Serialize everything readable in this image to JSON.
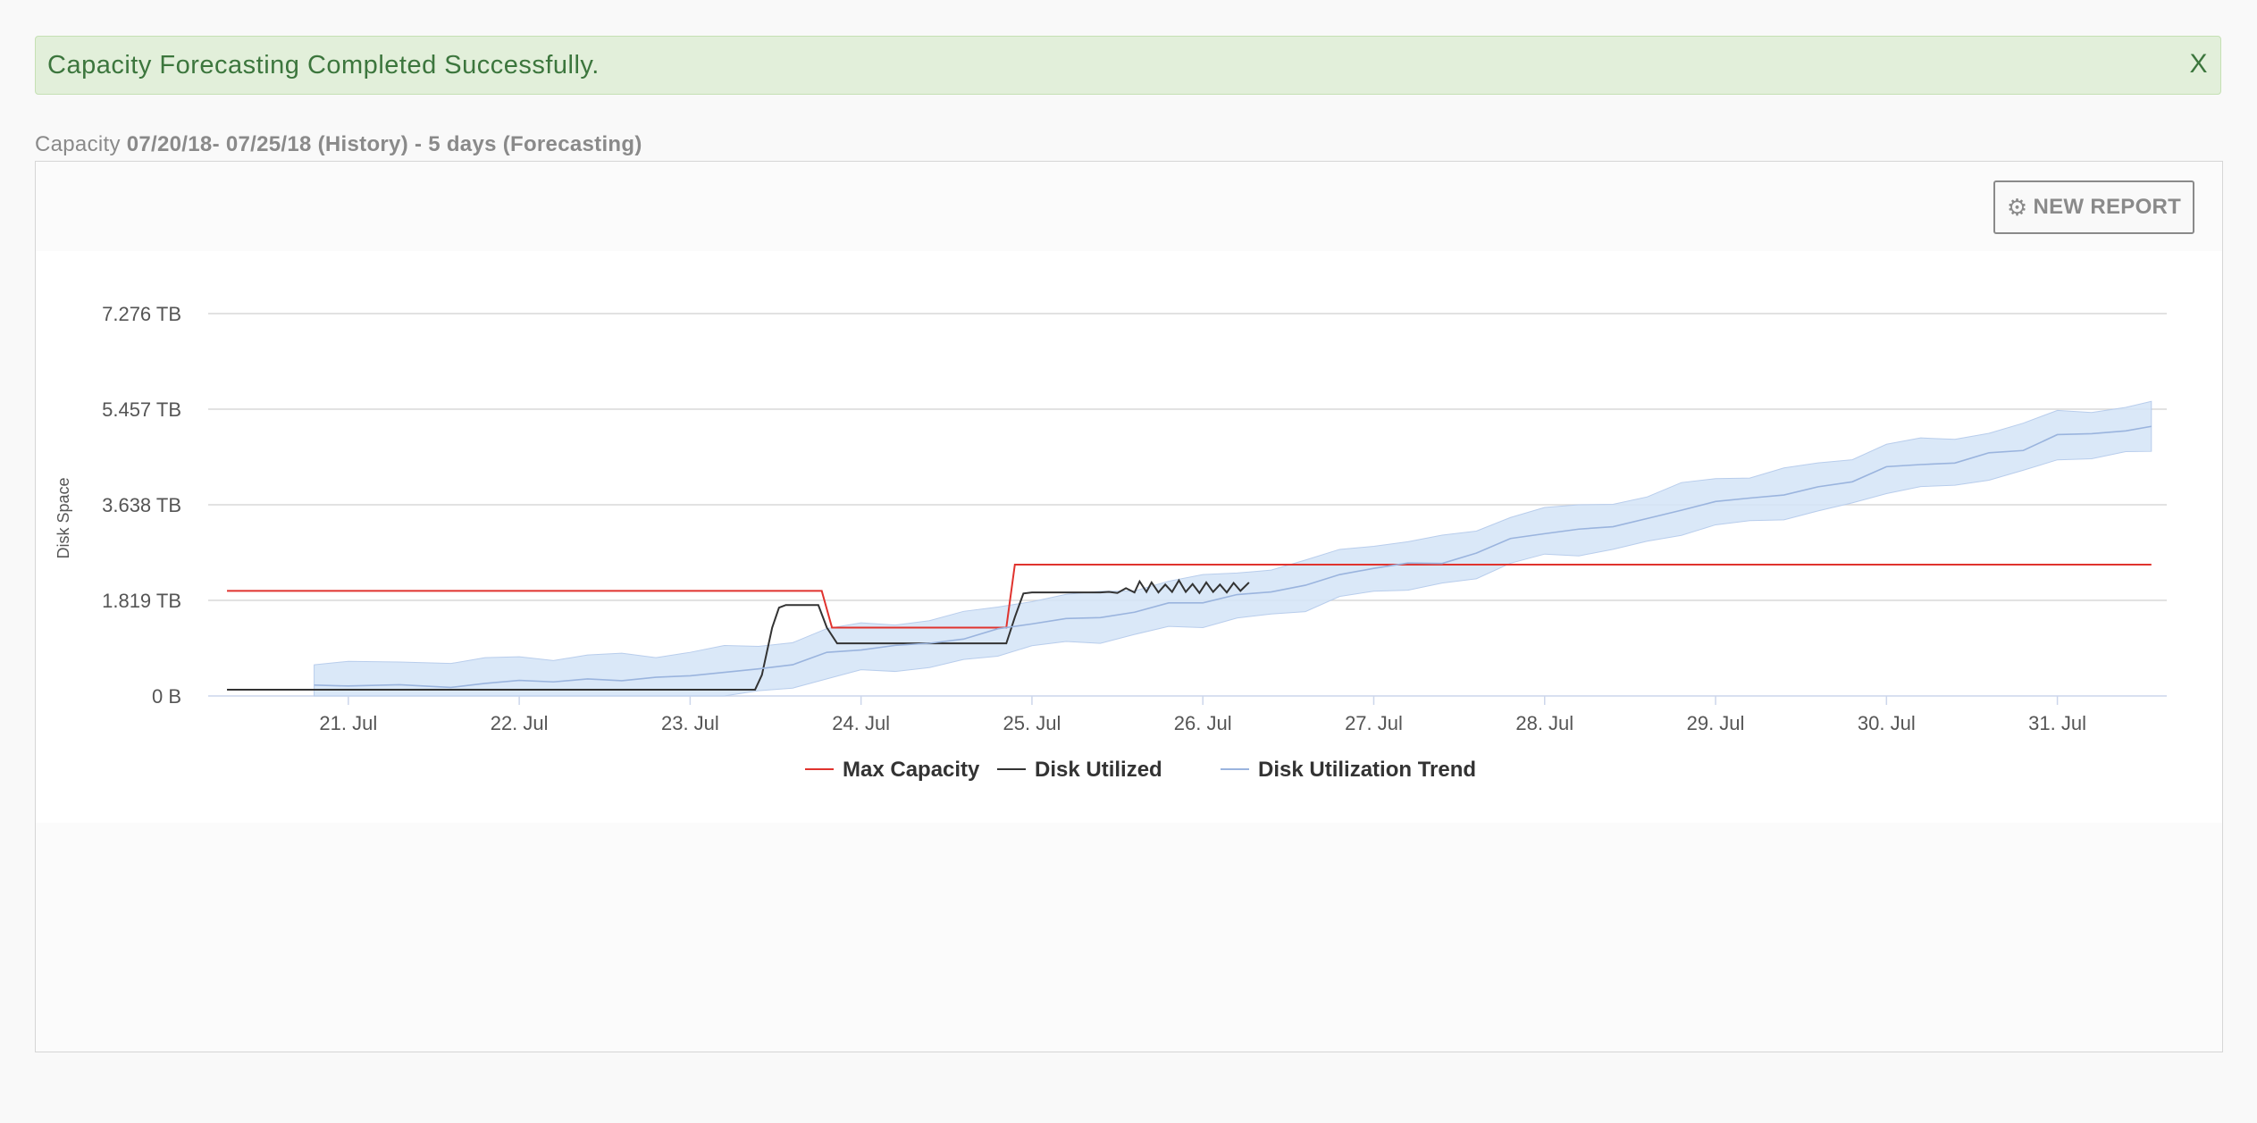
{
  "alert": {
    "message": "Capacity Forecasting Completed Successfully.",
    "close_label": "X"
  },
  "caption": {
    "prefix": "Capacity",
    "range": "07/20/18- 07/25/18 (History) - 5 days (Forecasting)"
  },
  "toolbar": {
    "new_report_label": "NEW REPORT",
    "new_report_icon": "gear-icon"
  },
  "colors": {
    "max_capacity": "#e0332e",
    "disk_utilized": "#333333",
    "trend_line": "#9ab4de",
    "trend_band": "#d4e4f7",
    "alert_bg": "#e2efda",
    "alert_text": "#3c763d"
  },
  "chart_data": {
    "type": "line",
    "title": "",
    "ylabel": "Disk Space",
    "xlabel": "",
    "x_unit": "day of July 2018",
    "xlim": [
      20.18,
      31.64
    ],
    "ylim": [
      0,
      7.276
    ],
    "y_unit": "TB",
    "y_ticks": [
      {
        "value": 0,
        "label": "0 B"
      },
      {
        "value": 1.819,
        "label": "1.819 TB"
      },
      {
        "value": 3.638,
        "label": "3.638 TB"
      },
      {
        "value": 5.457,
        "label": "5.457 TB"
      },
      {
        "value": 7.276,
        "label": "7.276 TB"
      }
    ],
    "x_ticks": [
      {
        "value": 21,
        "label": "21. Jul"
      },
      {
        "value": 22,
        "label": "22. Jul"
      },
      {
        "value": 23,
        "label": "23. Jul"
      },
      {
        "value": 24,
        "label": "24. Jul"
      },
      {
        "value": 25,
        "label": "25. Jul"
      },
      {
        "value": 26,
        "label": "26. Jul"
      },
      {
        "value": 27,
        "label": "27. Jul"
      },
      {
        "value": 28,
        "label": "28. Jul"
      },
      {
        "value": 29,
        "label": "29. Jul"
      },
      {
        "value": 30,
        "label": "30. Jul"
      },
      {
        "value": 31,
        "label": "31. Jul"
      }
    ],
    "grid": true,
    "legend_position": "bottom-center",
    "series": [
      {
        "name": "Max Capacity",
        "kind": "line",
        "color": "#e0332e",
        "points": [
          [
            20.29,
            2.0
          ],
          [
            23.77,
            2.0
          ],
          [
            23.83,
            1.3
          ],
          [
            24.85,
            1.3
          ],
          [
            24.9,
            2.5
          ],
          [
            31.55,
            2.5
          ]
        ]
      },
      {
        "name": "Disk Utilized",
        "kind": "line",
        "color": "#333333",
        "points": [
          [
            20.29,
            0.12
          ],
          [
            23.38,
            0.12
          ],
          [
            23.42,
            0.4
          ],
          [
            23.48,
            1.3
          ],
          [
            23.52,
            1.68
          ],
          [
            23.56,
            1.73
          ],
          [
            23.75,
            1.73
          ],
          [
            23.8,
            1.3
          ],
          [
            23.86,
            1.0
          ],
          [
            24.85,
            1.0
          ],
          [
            24.9,
            1.5
          ],
          [
            24.95,
            1.95
          ],
          [
            25.0,
            1.97
          ],
          [
            25.4,
            1.97
          ],
          [
            25.45,
            1.98
          ],
          [
            25.5,
            1.96
          ],
          [
            25.55,
            2.05
          ],
          [
            25.6,
            1.97
          ],
          [
            25.63,
            2.18
          ],
          [
            25.67,
            1.98
          ],
          [
            25.7,
            2.16
          ],
          [
            25.74,
            1.97
          ],
          [
            25.78,
            2.12
          ],
          [
            25.82,
            1.98
          ],
          [
            25.86,
            2.2
          ],
          [
            25.9,
            1.98
          ],
          [
            25.94,
            2.13
          ],
          [
            25.98,
            1.96
          ],
          [
            26.02,
            2.16
          ],
          [
            26.06,
            1.98
          ],
          [
            26.1,
            2.12
          ],
          [
            26.14,
            1.97
          ],
          [
            26.18,
            2.15
          ],
          [
            26.22,
            2.0
          ],
          [
            26.27,
            2.16
          ]
        ]
      },
      {
        "name": "Disk Utilization Trend",
        "kind": "arearange-line",
        "color": "#9ab4de",
        "points": [
          [
            20.8,
            0.2
          ],
          [
            21.0,
            0.18
          ],
          [
            21.3,
            0.2
          ],
          [
            21.6,
            0.19
          ],
          [
            21.8,
            0.22
          ],
          [
            22.0,
            0.3
          ],
          [
            22.2,
            0.28
          ],
          [
            22.4,
            0.3
          ],
          [
            22.6,
            0.32
          ],
          [
            22.8,
            0.33
          ],
          [
            23.0,
            0.4
          ],
          [
            23.2,
            0.45
          ],
          [
            23.4,
            0.5
          ],
          [
            23.6,
            0.62
          ],
          [
            23.8,
            0.8
          ],
          [
            24.0,
            0.9
          ],
          [
            24.2,
            0.95
          ],
          [
            24.4,
            1.0
          ],
          [
            24.6,
            1.1
          ],
          [
            24.8,
            1.25
          ],
          [
            25.0,
            1.4
          ],
          [
            25.2,
            1.45
          ],
          [
            25.4,
            1.5
          ],
          [
            25.6,
            1.6
          ],
          [
            25.8,
            1.75
          ],
          [
            26.0,
            1.8
          ],
          [
            26.2,
            1.9
          ],
          [
            26.4,
            2.0
          ],
          [
            26.6,
            2.1
          ],
          [
            26.8,
            2.3
          ],
          [
            27.0,
            2.45
          ],
          [
            27.2,
            2.5
          ],
          [
            27.4,
            2.55
          ],
          [
            27.6,
            2.7
          ],
          [
            27.8,
            3.0
          ],
          [
            28.0,
            3.1
          ],
          [
            28.2,
            3.15
          ],
          [
            28.4,
            3.25
          ],
          [
            28.6,
            3.35
          ],
          [
            28.8,
            3.55
          ],
          [
            29.0,
            3.7
          ],
          [
            29.2,
            3.75
          ],
          [
            29.4,
            3.85
          ],
          [
            29.6,
            3.95
          ],
          [
            29.8,
            4.1
          ],
          [
            30.0,
            4.35
          ],
          [
            30.2,
            4.4
          ],
          [
            30.4,
            4.45
          ],
          [
            30.6,
            4.6
          ],
          [
            30.8,
            4.7
          ],
          [
            31.0,
            4.95
          ],
          [
            31.2,
            5.0
          ],
          [
            31.4,
            5.05
          ],
          [
            31.55,
            5.1
          ]
        ],
        "band_halfwidth": 0.45
      }
    ]
  }
}
